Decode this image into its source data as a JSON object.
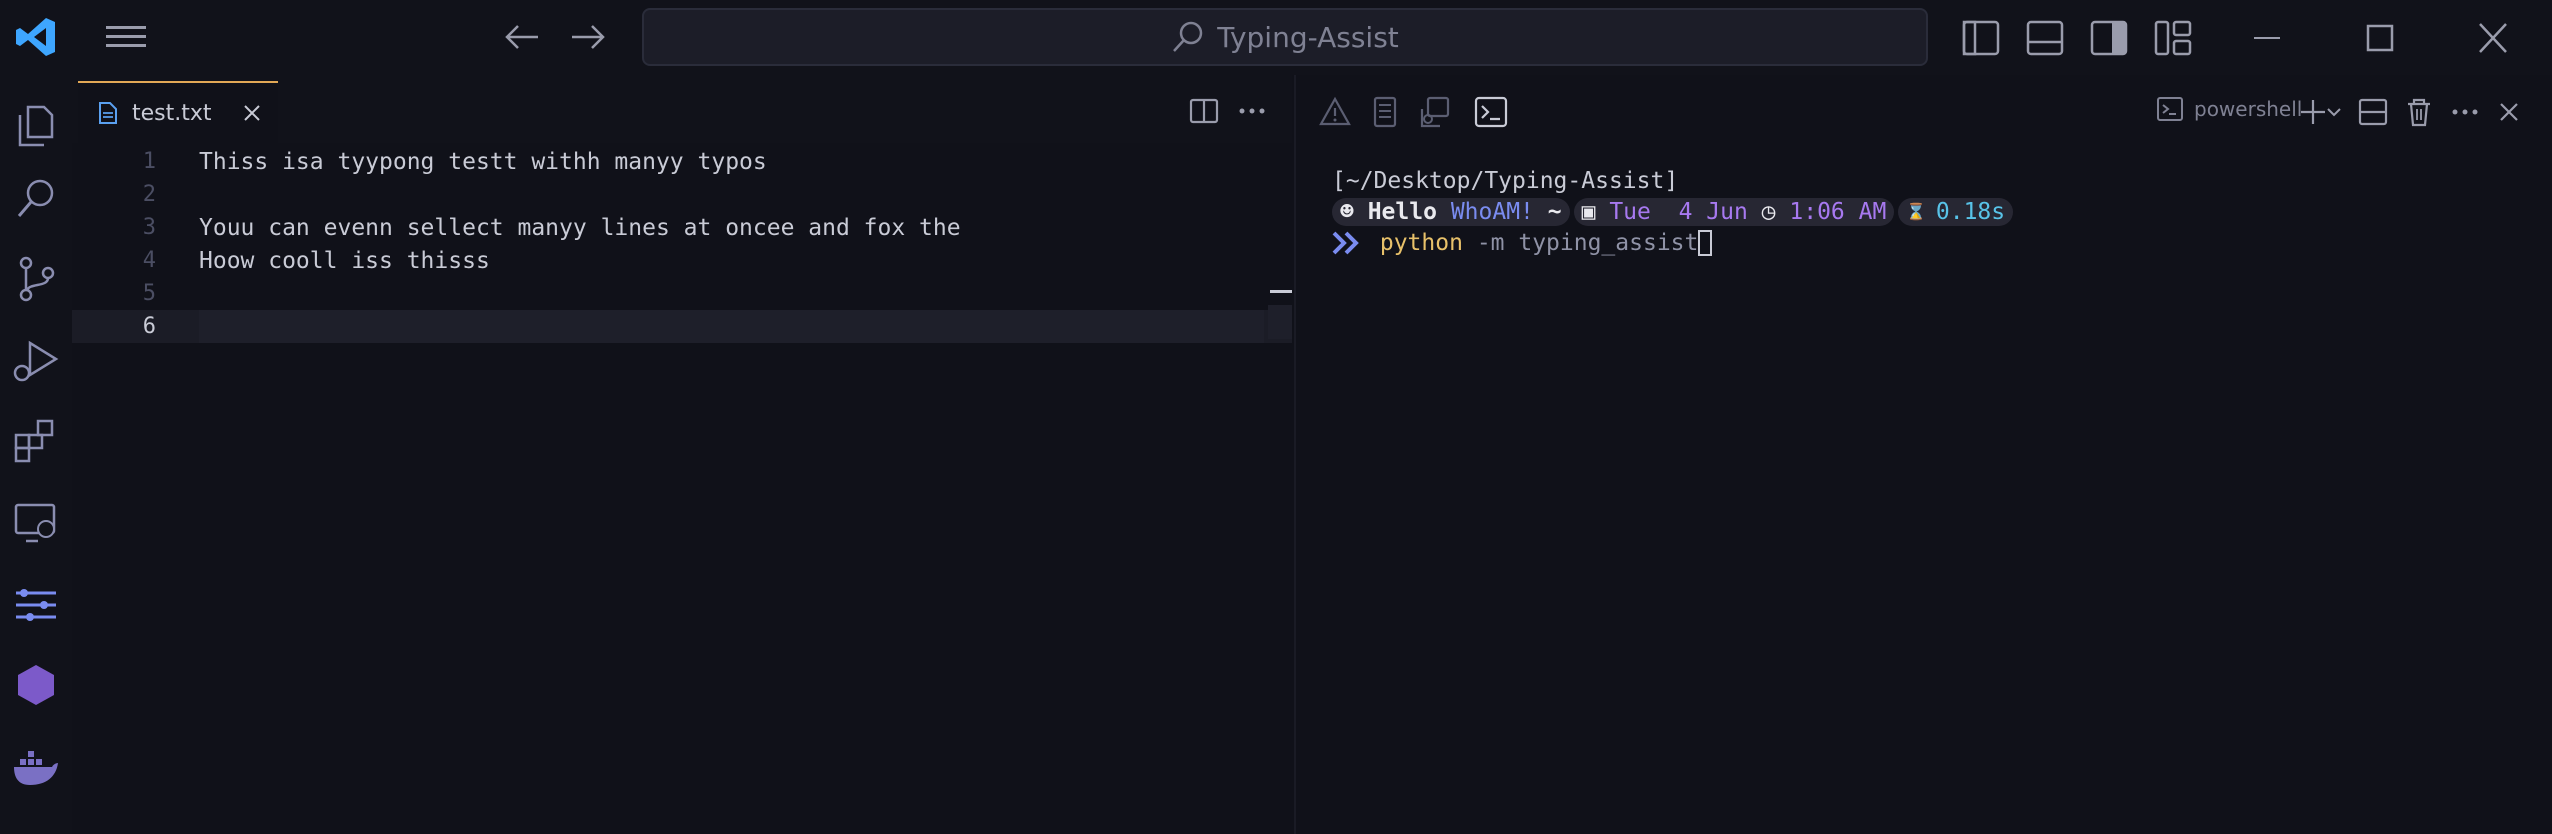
{
  "titlebar": {
    "search_text": "Typing-Assist"
  },
  "editor": {
    "tab": {
      "label": "test.txt"
    },
    "lines": [
      {
        "number": "1",
        "text": "Thiss isa tyypong testt withh manyy typos"
      },
      {
        "number": "2",
        "text": ""
      },
      {
        "number": "3",
        "text": "Youu can evenn sellect manyy lines at oncee and fox the"
      },
      {
        "number": "4",
        "text": "Hoow cooll iss thisss"
      },
      {
        "number": "5",
        "text": ""
      },
      {
        "number": "6",
        "text": ""
      }
    ]
  },
  "terminal": {
    "shell_label": "powershell",
    "cwd": "[~/Desktop/Typing-Assist]",
    "prompt": {
      "hello": "Hello",
      "user": "WhoAM!",
      "tilde": "~",
      "day": "Tue",
      "date": "4 Jun",
      "time": "1:06 AM",
      "duration": "0.18s"
    },
    "command": {
      "name": "python",
      "args": "-m typing_assist"
    }
  },
  "colors": {
    "accent": "#3ea6ff",
    "tab_border": "#e2a856",
    "prompt_purple": "#a779f0",
    "prompt_blue": "#7a8cf0",
    "prompt_cyan": "#58c3e8",
    "command_yellow": "#e8c16a"
  }
}
